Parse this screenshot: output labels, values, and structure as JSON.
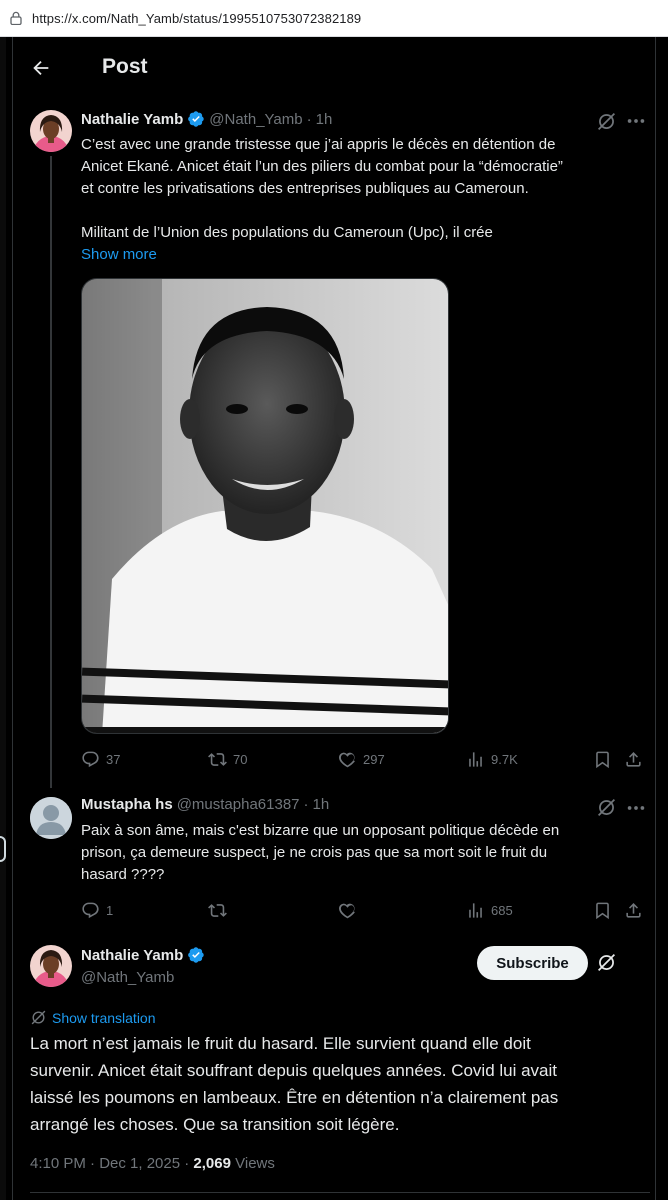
{
  "browser": {
    "url": "https://x.com/Nath_Yamb/status/1995510753072382189"
  },
  "header": {
    "title": "Post"
  },
  "parent_post": {
    "name": "Nathalie Yamb",
    "handle": "@Nath_Yamb",
    "time": "1h",
    "paragraph1_line1": "C’est avec une grande tristesse que j’ai appris le décès en détention de",
    "paragraph1_line2": "Anicet Ekané. Anicet était l’un des piliers du combat pour la “démocratie”",
    "paragraph1_line3": "et contre les privatisations des entreprises publiques au Cameroun.",
    "paragraph2": "Militant de l’Union des populations du Cameroun (Upc), il crée",
    "show_more": "Show more",
    "stats": {
      "replies": "37",
      "reposts": "70",
      "likes": "297",
      "views": "9.7K"
    }
  },
  "reply": {
    "name": "Mustapha hs",
    "handle": "@mustapha61387",
    "time": "1h",
    "line1": "Paix à son âme, mais c'est bizarre que un opposant politique décède en",
    "line2": "prison, ça demeure suspect, je ne crois pas que sa mort soit le fruit du",
    "line3": "hasard ????",
    "stats": {
      "replies": "1",
      "views": "685"
    }
  },
  "main_post": {
    "name": "Nathalie Yamb",
    "handle": "@Nath_Yamb",
    "subscribe_label": "Subscribe",
    "show_translation": "Show translation",
    "line1": "La mort n’est jamais le fruit du hasard. Elle survient quand elle doit",
    "line2": "survenir. Anicet était souffrant depuis quelques années. Covid lui avait",
    "line3": "laissé les poumons en lambeaux. Être en détention n’a clairement pas",
    "line4": "arrangé les choses. Que sa transition soit légère.",
    "timestamp": "4:10 PM · Dec 1, 2025 · ",
    "views_count": "2,069",
    "views_label": " Views"
  },
  "colors": {
    "background": "#000000",
    "text": "#e7e9ea",
    "muted": "#71767b",
    "link": "#1d9bf0",
    "verified": "#1d9bf0",
    "border": "#2f3336"
  },
  "icons": [
    "lock-icon",
    "back-arrow-icon",
    "verified-badge-icon",
    "grok-icon",
    "more-icon",
    "reply-icon",
    "repost-icon",
    "like-icon",
    "views-icon",
    "bookmark-icon",
    "share-icon",
    "translate-icon"
  ]
}
